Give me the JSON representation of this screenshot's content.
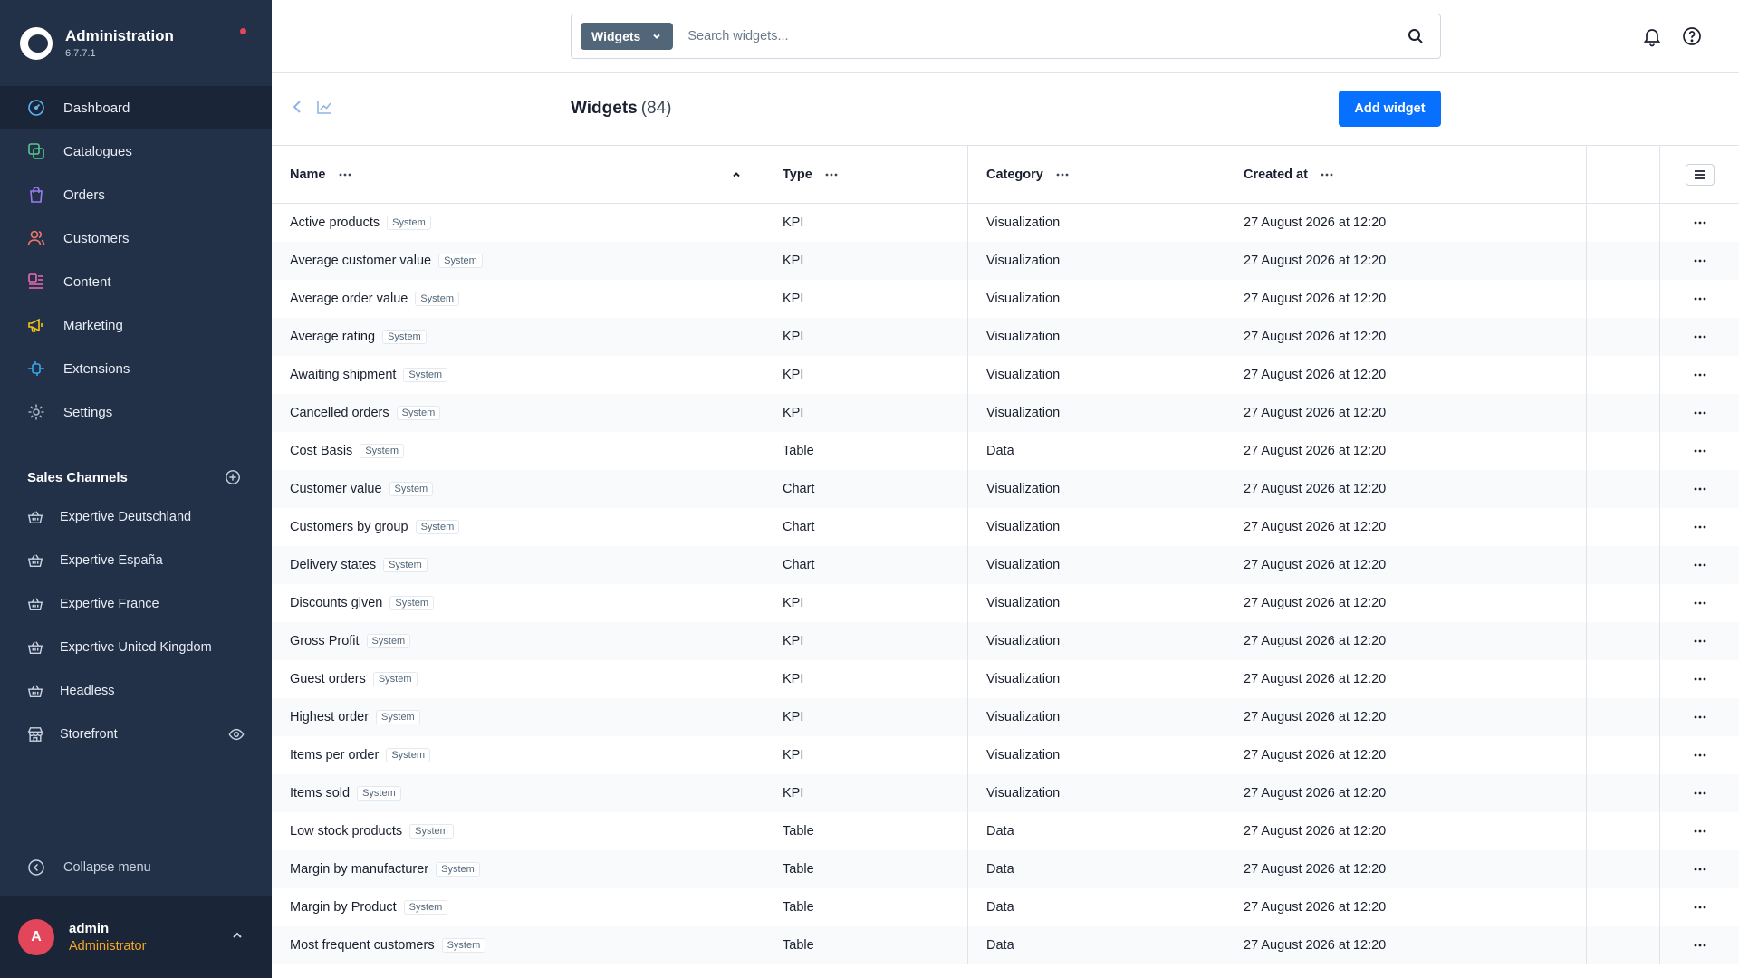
{
  "brand": {
    "title": "Administration",
    "version": "6.7.7.1"
  },
  "nav": [
    {
      "label": "Dashboard",
      "icon": "gauge-icon",
      "color": "#5fb3f5"
    },
    {
      "label": "Catalogues",
      "icon": "catalogue-icon",
      "color": "#55c98b"
    },
    {
      "label": "Orders",
      "icon": "shopping-bag-icon",
      "color": "#9b7cf0"
    },
    {
      "label": "Customers",
      "icon": "users-icon",
      "color": "#f4766a"
    },
    {
      "label": "Content",
      "icon": "content-icon",
      "color": "#f06bb0"
    },
    {
      "label": "Marketing",
      "icon": "megaphone-icon",
      "color": "#f5c518"
    },
    {
      "label": "Extensions",
      "icon": "plug-icon",
      "color": "#3aa7e8"
    },
    {
      "label": "Settings",
      "icon": "gear-icon",
      "color": "#aab6c5"
    }
  ],
  "sales_channels": {
    "title": "Sales Channels",
    "items": [
      {
        "label": "Expertive Deutschland",
        "icon": "basket-icon"
      },
      {
        "label": "Expertive España",
        "icon": "basket-icon"
      },
      {
        "label": "Expertive France",
        "icon": "basket-icon"
      },
      {
        "label": "Expertive United Kingdom",
        "icon": "basket-icon"
      },
      {
        "label": "Headless",
        "icon": "basket-icon"
      },
      {
        "label": "Storefront",
        "icon": "storefront-icon"
      }
    ]
  },
  "collapse_label": "Collapse menu",
  "user": {
    "initial": "A",
    "name": "admin",
    "role": "Administrator"
  },
  "search": {
    "type_label": "Widgets",
    "placeholder": "Search widgets..."
  },
  "page": {
    "title": "Widgets",
    "count": "(84)",
    "add_label": "Add widget"
  },
  "columns": {
    "name": "Name",
    "type": "Type",
    "category": "Category",
    "created": "Created at"
  },
  "badge_label": "System",
  "rows": [
    {
      "name": "Active products",
      "type": "KPI",
      "category": "Visualization",
      "created": "27 August 2026 at 12:20"
    },
    {
      "name": "Average customer value",
      "type": "KPI",
      "category": "Visualization",
      "created": "27 August 2026 at 12:20"
    },
    {
      "name": "Average order value",
      "type": "KPI",
      "category": "Visualization",
      "created": "27 August 2026 at 12:20"
    },
    {
      "name": "Average rating",
      "type": "KPI",
      "category": "Visualization",
      "created": "27 August 2026 at 12:20"
    },
    {
      "name": "Awaiting shipment",
      "type": "KPI",
      "category": "Visualization",
      "created": "27 August 2026 at 12:20"
    },
    {
      "name": "Cancelled orders",
      "type": "KPI",
      "category": "Visualization",
      "created": "27 August 2026 at 12:20"
    },
    {
      "name": "Cost Basis",
      "type": "Table",
      "category": "Data",
      "created": "27 August 2026 at 12:20"
    },
    {
      "name": "Customer value",
      "type": "Chart",
      "category": "Visualization",
      "created": "27 August 2026 at 12:20"
    },
    {
      "name": "Customers by group",
      "type": "Chart",
      "category": "Visualization",
      "created": "27 August 2026 at 12:20"
    },
    {
      "name": "Delivery states",
      "type": "Chart",
      "category": "Visualization",
      "created": "27 August 2026 at 12:20"
    },
    {
      "name": "Discounts given",
      "type": "KPI",
      "category": "Visualization",
      "created": "27 August 2026 at 12:20"
    },
    {
      "name": "Gross Profit",
      "type": "KPI",
      "category": "Visualization",
      "created": "27 August 2026 at 12:20"
    },
    {
      "name": "Guest orders",
      "type": "KPI",
      "category": "Visualization",
      "created": "27 August 2026 at 12:20"
    },
    {
      "name": "Highest order",
      "type": "KPI",
      "category": "Visualization",
      "created": "27 August 2026 at 12:20"
    },
    {
      "name": "Items per order",
      "type": "KPI",
      "category": "Visualization",
      "created": "27 August 2026 at 12:20"
    },
    {
      "name": "Items sold",
      "type": "KPI",
      "category": "Visualization",
      "created": "27 August 2026 at 12:20"
    },
    {
      "name": "Low stock products",
      "type": "Table",
      "category": "Data",
      "created": "27 August 2026 at 12:20"
    },
    {
      "name": "Margin by manufacturer",
      "type": "Table",
      "category": "Data",
      "created": "27 August 2026 at 12:20"
    },
    {
      "name": "Margin by Product",
      "type": "Table",
      "category": "Data",
      "created": "27 August 2026 at 12:20"
    },
    {
      "name": "Most frequent customers",
      "type": "Table",
      "category": "Data",
      "created": "27 August 2026 at 12:20"
    }
  ],
  "colors": {
    "sidebar": "#223048",
    "accent": "#0870ff",
    "alert": "#e3455a",
    "role": "#f5a623"
  }
}
